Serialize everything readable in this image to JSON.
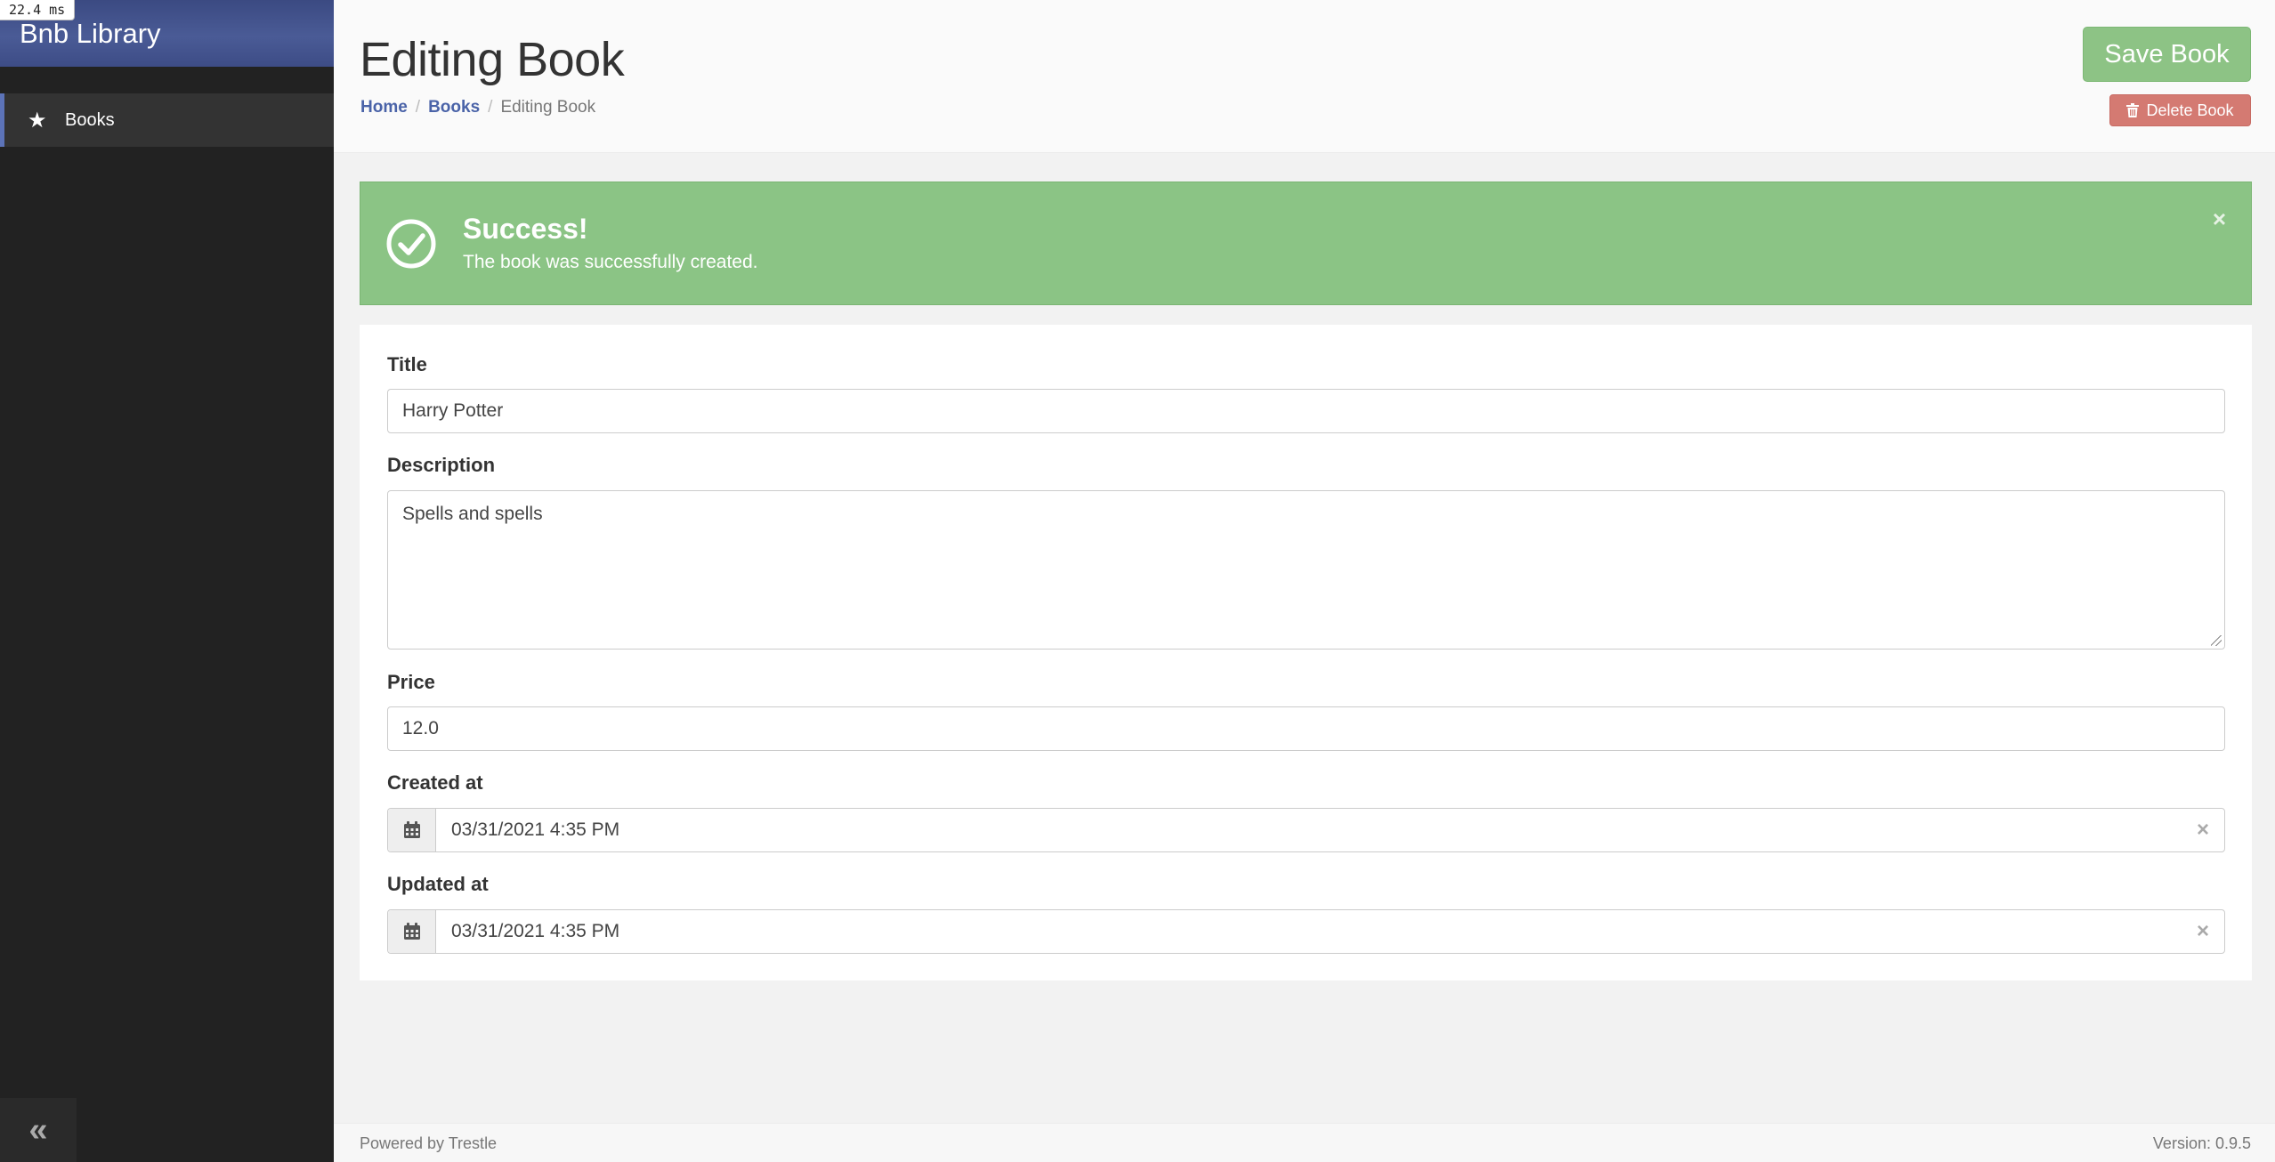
{
  "app": {
    "title": "Bnb Library",
    "timing": "22.4 ms"
  },
  "sidebar": {
    "items": [
      {
        "label": "Books",
        "icon": "star-icon"
      }
    ],
    "collapse_glyph": "«"
  },
  "header": {
    "title": "Editing Book",
    "breadcrumb": [
      "Home",
      "Books",
      "Editing Book"
    ],
    "save_label": "Save Book",
    "delete_label": "Delete Book"
  },
  "alert": {
    "title": "Success!",
    "message": "The book was successfully created.",
    "close_glyph": "×"
  },
  "form": {
    "title_label": "Title",
    "title_value": "Harry Potter",
    "description_label": "Description",
    "description_value": "Spells and spells",
    "price_label": "Price",
    "price_value": "12.0",
    "created_label": "Created at",
    "created_value": "03/31/2021 4:35 PM",
    "updated_label": "Updated at",
    "updated_value": "03/31/2021 4:35 PM",
    "clear_glyph": "×"
  },
  "footer": {
    "powered_by": "Powered by Trestle",
    "version": "Version: 0.9.5"
  },
  "colors": {
    "sidebar_bg": "#222222",
    "brand_bg": "#4a5b96",
    "accent": "#4a63a8",
    "success": "#8bc485",
    "danger": "#d47a72"
  }
}
